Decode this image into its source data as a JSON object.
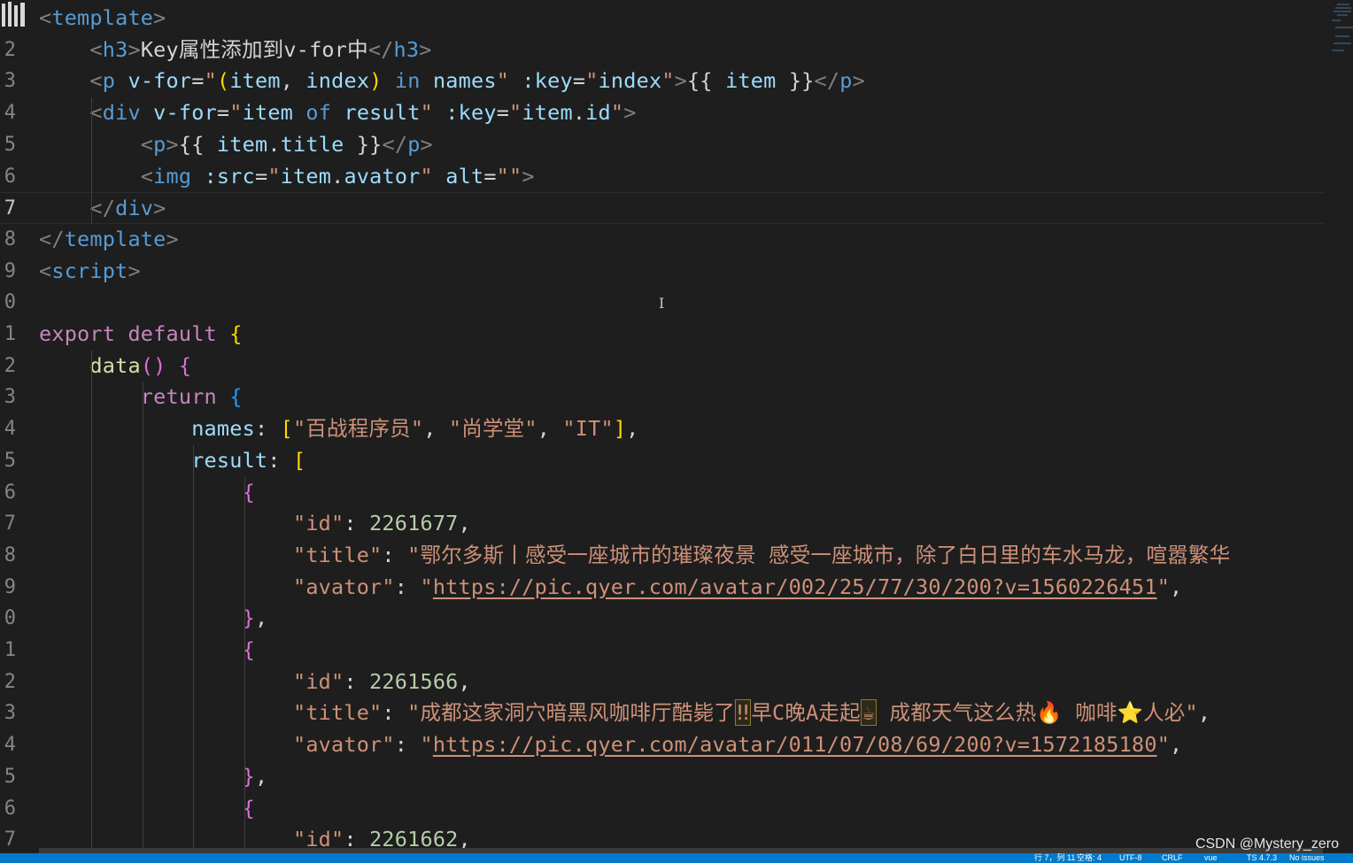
{
  "editor": {
    "lines": [
      {
        "n": "",
        "tokens": [
          [
            "brk",
            "<"
          ],
          [
            "tag",
            "template"
          ],
          [
            "brk",
            ">"
          ]
        ]
      },
      {
        "n": "2",
        "tokens": [
          [
            "sp",
            "    "
          ],
          [
            "brk",
            "<"
          ],
          [
            "tag",
            "h3"
          ],
          [
            "brk",
            ">"
          ],
          [
            "text",
            "Key属性添加到v-for中"
          ],
          [
            "brk",
            "</"
          ],
          [
            "tag",
            "h3"
          ],
          [
            "brk",
            ">"
          ]
        ]
      },
      {
        "n": "3",
        "tokens": [
          [
            "sp",
            "    "
          ],
          [
            "brk",
            "<"
          ],
          [
            "tag",
            "p"
          ],
          [
            "sp",
            " "
          ],
          [
            "attr",
            "v-for"
          ],
          [
            "text",
            "="
          ],
          [
            "str",
            "\""
          ],
          [
            "b1",
            "("
          ],
          [
            "var",
            "item"
          ],
          [
            "text",
            ", "
          ],
          [
            "var",
            "index"
          ],
          [
            "b1",
            ")"
          ],
          [
            "sp",
            " "
          ],
          [
            "tag",
            "in"
          ],
          [
            "sp",
            " "
          ],
          [
            "var",
            "names"
          ],
          [
            "str",
            "\""
          ],
          [
            "sp",
            " "
          ],
          [
            "attr",
            ":key"
          ],
          [
            "text",
            "="
          ],
          [
            "str",
            "\""
          ],
          [
            "var",
            "index"
          ],
          [
            "str",
            "\""
          ],
          [
            "brk",
            ">"
          ],
          [
            "text",
            "{{ "
          ],
          [
            "var",
            "item"
          ],
          [
            "text",
            " }}"
          ],
          [
            "brk",
            "</"
          ],
          [
            "tag",
            "p"
          ],
          [
            "brk",
            ">"
          ]
        ]
      },
      {
        "n": "4",
        "tokens": [
          [
            "sp",
            "    "
          ],
          [
            "brk",
            "<"
          ],
          [
            "tag",
            "div"
          ],
          [
            "sp",
            " "
          ],
          [
            "attr",
            "v-for"
          ],
          [
            "text",
            "="
          ],
          [
            "str",
            "\""
          ],
          [
            "var",
            "item"
          ],
          [
            "sp",
            " "
          ],
          [
            "tag",
            "of"
          ],
          [
            "sp",
            " "
          ],
          [
            "var",
            "result"
          ],
          [
            "str",
            "\""
          ],
          [
            "sp",
            " "
          ],
          [
            "attr",
            ":key"
          ],
          [
            "text",
            "="
          ],
          [
            "str",
            "\""
          ],
          [
            "var",
            "item"
          ],
          [
            "text",
            "."
          ],
          [
            "var",
            "id"
          ],
          [
            "str",
            "\""
          ],
          [
            "brk",
            ">"
          ]
        ]
      },
      {
        "n": "5",
        "tokens": [
          [
            "sp",
            "        "
          ],
          [
            "brk",
            "<"
          ],
          [
            "tag",
            "p"
          ],
          [
            "brk",
            ">"
          ],
          [
            "text",
            "{{ "
          ],
          [
            "var",
            "item"
          ],
          [
            "text",
            "."
          ],
          [
            "var",
            "title"
          ],
          [
            "text",
            " }}"
          ],
          [
            "brk",
            "</"
          ],
          [
            "tag",
            "p"
          ],
          [
            "brk",
            ">"
          ]
        ]
      },
      {
        "n": "6",
        "tokens": [
          [
            "sp",
            "        "
          ],
          [
            "brk",
            "<"
          ],
          [
            "tag",
            "img"
          ],
          [
            "sp",
            " "
          ],
          [
            "attr",
            ":src"
          ],
          [
            "text",
            "="
          ],
          [
            "str",
            "\""
          ],
          [
            "var",
            "item"
          ],
          [
            "text",
            "."
          ],
          [
            "var",
            "avator"
          ],
          [
            "str",
            "\""
          ],
          [
            "sp",
            " "
          ],
          [
            "attr",
            "alt"
          ],
          [
            "text",
            "="
          ],
          [
            "str",
            "\"\""
          ],
          [
            "brk",
            ">"
          ]
        ]
      },
      {
        "n": "7",
        "current": true,
        "tokens": [
          [
            "sp",
            "    "
          ],
          [
            "brk",
            "</"
          ],
          [
            "tag",
            "div"
          ],
          [
            "brk",
            ">"
          ]
        ]
      },
      {
        "n": "8",
        "tokens": [
          [
            "brk",
            "</"
          ],
          [
            "tag",
            "template"
          ],
          [
            "brk",
            ">"
          ]
        ]
      },
      {
        "n": "9",
        "tokens": [
          [
            "brk",
            "<"
          ],
          [
            "tag",
            "script"
          ],
          [
            "brk",
            ">"
          ]
        ]
      },
      {
        "n": "0",
        "tokens": []
      },
      {
        "n": "1",
        "tokens": [
          [
            "kw",
            "export"
          ],
          [
            "sp",
            " "
          ],
          [
            "kw",
            "default"
          ],
          [
            "sp",
            " "
          ],
          [
            "b1",
            "{"
          ]
        ]
      },
      {
        "n": "2",
        "tokens": [
          [
            "sp",
            "    "
          ],
          [
            "fn",
            "data"
          ],
          [
            "b2",
            "()"
          ],
          [
            "sp",
            " "
          ],
          [
            "b2",
            "{"
          ]
        ]
      },
      {
        "n": "3",
        "tokens": [
          [
            "sp",
            "        "
          ],
          [
            "kw",
            "return"
          ],
          [
            "sp",
            " "
          ],
          [
            "b3",
            "{"
          ]
        ]
      },
      {
        "n": "4",
        "tokens": [
          [
            "sp",
            "            "
          ],
          [
            "prop",
            "names"
          ],
          [
            "text",
            ": "
          ],
          [
            "b1",
            "["
          ],
          [
            "str",
            "\"百战程序员\""
          ],
          [
            "text",
            ", "
          ],
          [
            "str",
            "\"尚学堂\""
          ],
          [
            "text",
            ", "
          ],
          [
            "str",
            "\"IT\""
          ],
          [
            "b1",
            "]"
          ],
          [
            "text",
            ","
          ]
        ]
      },
      {
        "n": "5",
        "tokens": [
          [
            "sp",
            "            "
          ],
          [
            "prop",
            "result"
          ],
          [
            "text",
            ": "
          ],
          [
            "b1",
            "["
          ]
        ]
      },
      {
        "n": "6",
        "tokens": [
          [
            "sp",
            "                "
          ],
          [
            "b2",
            "{"
          ]
        ]
      },
      {
        "n": "7",
        "tokens": [
          [
            "sp",
            "                    "
          ],
          [
            "str",
            "\"id\""
          ],
          [
            "text",
            ": "
          ],
          [
            "num",
            "2261677"
          ],
          [
            "text",
            ","
          ]
        ]
      },
      {
        "n": "8",
        "tokens": [
          [
            "sp",
            "                    "
          ],
          [
            "str",
            "\"title\""
          ],
          [
            "text",
            ": "
          ],
          [
            "str",
            "\"鄂尔多斯丨感受一座城市的璀璨夜景 感受一座城市，除了白日里的车水马龙，喧嚣繁华"
          ]
        ]
      },
      {
        "n": "9",
        "tokens": [
          [
            "sp",
            "                    "
          ],
          [
            "str",
            "\"avator\""
          ],
          [
            "text",
            ": "
          ],
          [
            "str",
            "\""
          ],
          [
            "link",
            "https://pic.qyer.com/avatar/002/25/77/30/200?v=1560226451"
          ],
          [
            "str",
            "\""
          ],
          [
            "text",
            ","
          ]
        ]
      },
      {
        "n": "0",
        "tokens": [
          [
            "sp",
            "                "
          ],
          [
            "b2",
            "}"
          ],
          [
            "text",
            ","
          ]
        ]
      },
      {
        "n": "1",
        "tokens": [
          [
            "sp",
            "                "
          ],
          [
            "b2",
            "{"
          ]
        ]
      },
      {
        "n": "2",
        "tokens": [
          [
            "sp",
            "                    "
          ],
          [
            "str",
            "\"id\""
          ],
          [
            "text",
            ": "
          ],
          [
            "num",
            "2261566"
          ],
          [
            "text",
            ","
          ]
        ]
      },
      {
        "n": "3",
        "tokens": [
          [
            "sp",
            "                    "
          ],
          [
            "str",
            "\"title\""
          ],
          [
            "text",
            ": "
          ],
          [
            "str",
            "\"成都这家洞穴暗黑风咖啡厅酷毙了"
          ],
          [
            "emoji",
            "‼"
          ],
          [
            "str",
            "早C晚A走起"
          ],
          [
            "emoji",
            "☕"
          ],
          [
            "str",
            " 成都天气这么热🔥 咖啡⭐人必\""
          ],
          [
            "text",
            ","
          ]
        ]
      },
      {
        "n": "4",
        "tokens": [
          [
            "sp",
            "                    "
          ],
          [
            "str",
            "\"avator\""
          ],
          [
            "text",
            ": "
          ],
          [
            "str",
            "\""
          ],
          [
            "link",
            "https://pic.qyer.com/avatar/011/07/08/69/200?v=1572185180"
          ],
          [
            "str",
            "\""
          ],
          [
            "text",
            ","
          ]
        ]
      },
      {
        "n": "5",
        "tokens": [
          [
            "sp",
            "                "
          ],
          [
            "b2",
            "}"
          ],
          [
            "text",
            ","
          ]
        ]
      },
      {
        "n": "6",
        "tokens": [
          [
            "sp",
            "                "
          ],
          [
            "b2",
            "{"
          ]
        ]
      },
      {
        "n": "7",
        "tokens": [
          [
            "sp",
            "                    "
          ],
          [
            "str",
            "\"id\""
          ],
          [
            "text",
            ": "
          ],
          [
            "num",
            "2261662"
          ],
          [
            "text",
            ","
          ]
        ]
      }
    ]
  },
  "watermark": "CSDN @Mystery_zero",
  "statusbar": {
    "items": [
      "行 7，列 11",
      "空格: 4",
      "UTF-8",
      "CRLF",
      "vue",
      "TS 4.7.3",
      "No issues"
    ]
  },
  "colors": {
    "background": "#1e1e1e",
    "statusbar": "#007acc",
    "tag": "#569cd6",
    "string": "#ce9178",
    "keyword": "#c586c0",
    "attr": "#9cdcfe"
  }
}
